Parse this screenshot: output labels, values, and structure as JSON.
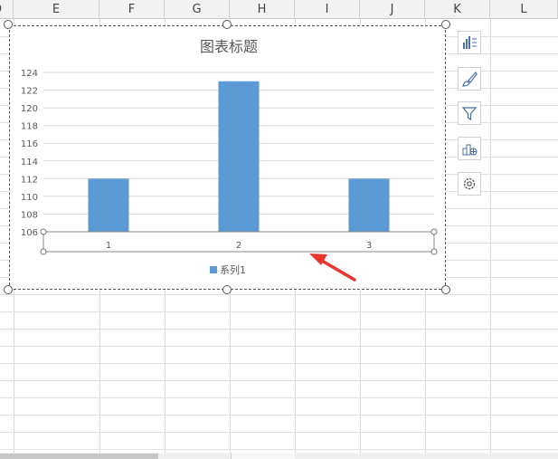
{
  "columns": [
    "D",
    "E",
    "F",
    "G",
    "H",
    "I",
    "J",
    "K",
    "L"
  ],
  "chart": {
    "title": "图表标题",
    "legend_label": "系列1"
  },
  "chart_data": {
    "type": "bar",
    "title": "图表标题",
    "categories": [
      "1",
      "2",
      "3"
    ],
    "series": [
      {
        "name": "系列1",
        "values": [
          112,
          123,
          112
        ]
      }
    ],
    "ylim": [
      106,
      124
    ],
    "yticks": [
      106,
      108,
      110,
      112,
      114,
      116,
      118,
      120,
      122,
      124
    ],
    "grid": true,
    "legend": "bottom"
  },
  "side_buttons": [
    {
      "icon": "chart-elements-icon"
    },
    {
      "icon": "chart-style-brush-icon"
    },
    {
      "icon": "chart-filter-icon"
    },
    {
      "icon": "chart-type-icon"
    },
    {
      "icon": "settings-gear-icon"
    }
  ],
  "colors": {
    "bar": "#5b9bd5",
    "annotation_arrow": "#e8362f"
  }
}
